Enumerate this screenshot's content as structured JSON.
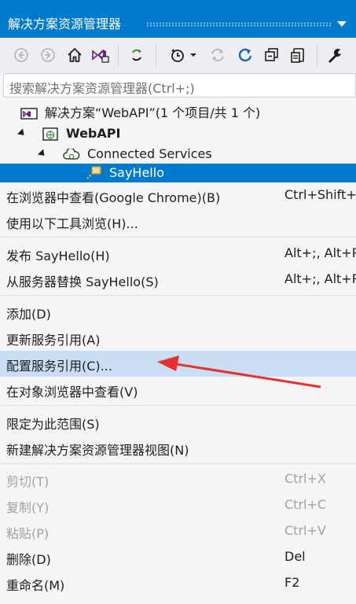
{
  "panel": {
    "title": "解决方案资源管理器"
  },
  "toolbar": {
    "buttons": [
      "back-icon",
      "forward-icon",
      "home-icon",
      "vs-switch-icon",
      "sync-icon",
      "history-icon",
      "history-dropdown-icon",
      "refresh-gray-icon",
      "refresh-icon",
      "collapse-icon",
      "copy-icon",
      "wrench-icon"
    ]
  },
  "search": {
    "placeholder": "搜索解决方案资源管理器(Ctrl+;)"
  },
  "tree": {
    "solution": "解决方案“WebAPI”(1 个项目/共 1 个)",
    "project": "WebAPI",
    "folder": "Connected Services",
    "item": "SayHello"
  },
  "menu": {
    "groups": [
      [
        {
          "label": "在浏览器中查看(Google Chrome)(B)",
          "shortcut": "Ctrl+Shift+W"
        },
        {
          "label": "使用以下工具浏览(H)...",
          "shortcut": ""
        }
      ],
      [
        {
          "label": "发布 SayHello(H)",
          "shortcut": "Alt+;, Alt+P"
        },
        {
          "label": "从服务器替换 SayHello(S)",
          "shortcut": "Alt+;, Alt+R"
        }
      ],
      [
        {
          "label": "添加(D)",
          "shortcut": ""
        },
        {
          "label": "更新服务引用(A)",
          "shortcut": ""
        },
        {
          "label": "配置服务引用(C)...",
          "shortcut": ""
        },
        {
          "label": "在对象浏览器中查看(V)",
          "shortcut": ""
        }
      ],
      [
        {
          "label": "限定为此范围(S)",
          "shortcut": ""
        },
        {
          "label": "新建解决方案资源管理器视图(N)",
          "shortcut": ""
        }
      ],
      [
        {
          "label": "剪切(T)",
          "shortcut": "Ctrl+X"
        },
        {
          "label": "复制(Y)",
          "shortcut": "Ctrl+C"
        },
        {
          "label": "粘贴(P)",
          "shortcut": "Ctrl+V"
        },
        {
          "label": "删除(D)",
          "shortcut": "Del"
        },
        {
          "label": "重命名(M)",
          "shortcut": "F2"
        }
      ]
    ]
  },
  "colors": {
    "accent": "#007acc",
    "highlight": "#c9def5",
    "disabled": "#a2a2a2",
    "annotation_arrow": "#e8302c"
  }
}
